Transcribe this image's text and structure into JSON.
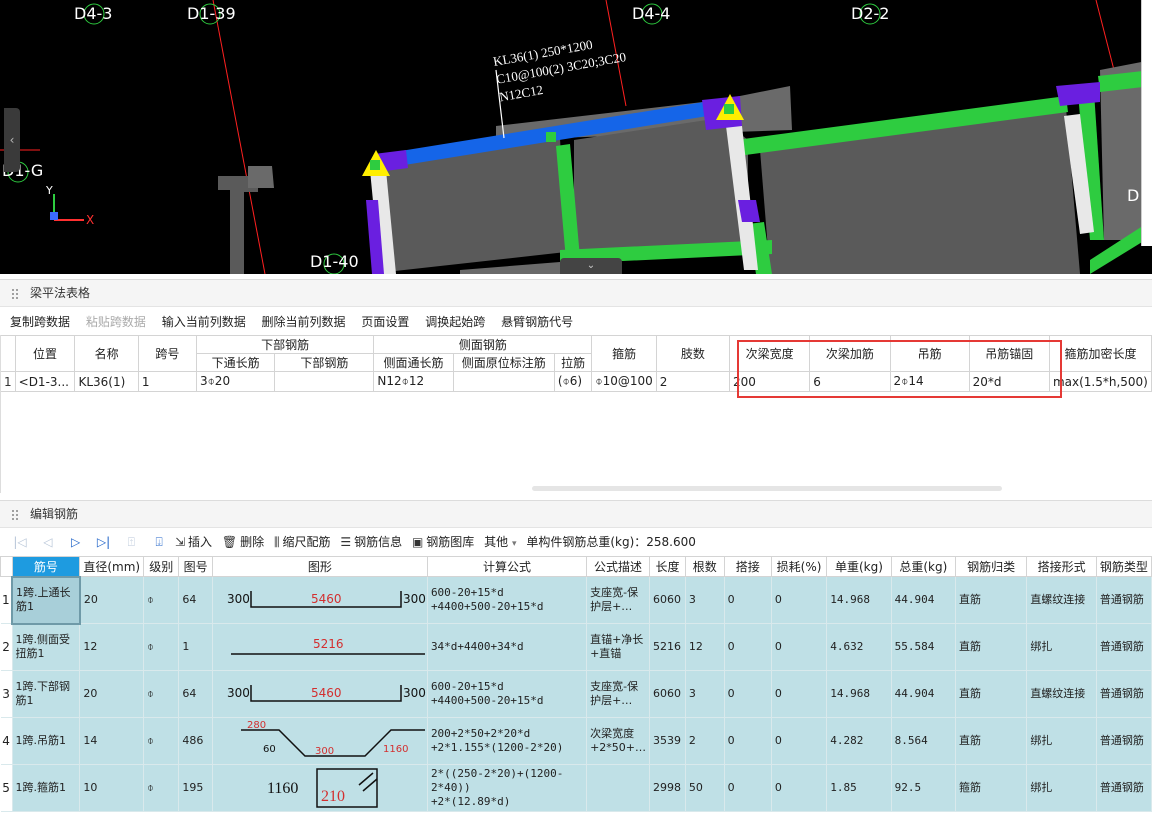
{
  "viewport": {
    "axis_labels": [
      "D4-3",
      "D1-39",
      "D4-4",
      "D2-2",
      "D1-G",
      "D1-40",
      "D"
    ],
    "beam_annotation": [
      "KL36(1) 250*1200",
      "C10@100(2) 3C20;3C20",
      "N12C12"
    ],
    "coord_axes": {
      "x": "X",
      "y": "Y"
    },
    "colors": {
      "background": "#000000",
      "beam_blue": "#1565e8",
      "beam_green": "#2ecc40",
      "column_purple": "#6a1fe0",
      "beam_gray": "#5a5a5a",
      "grid_red": "#ff2020"
    }
  },
  "beam_panel": {
    "title": "梁平法表格",
    "toolbar": [
      {
        "label": "复制跨数据",
        "enabled": true
      },
      {
        "label": "粘贴跨数据",
        "enabled": false
      },
      {
        "label": "输入当前列数据",
        "enabled": true
      },
      {
        "label": "删除当前列数据",
        "enabled": true
      },
      {
        "label": "页面设置",
        "enabled": true
      },
      {
        "label": "调换起始跨",
        "enabled": true
      },
      {
        "label": "悬臂钢筋代号",
        "enabled": true
      }
    ],
    "group_headers": {
      "bottom_rebar": "下部钢筋",
      "side_rebar": "侧面钢筋"
    },
    "headers": [
      "位置",
      "名称",
      "跨号",
      "下通长筋",
      "下部钢筋",
      "侧面通长筋",
      "侧面原位标注筋",
      "拉筋",
      "箍筋",
      "肢数",
      "次梁宽度",
      "次梁加筋",
      "吊筋",
      "吊筋锚固",
      "箍筋加密长度"
    ],
    "row": {
      "num": "1",
      "cells": [
        "<D1-3...",
        "KL36(1)",
        "1",
        "3⌽20",
        "",
        "N12⌽12",
        "",
        "(⌽6)",
        "⌽10@100",
        "2",
        "200",
        "6",
        "2⌽14",
        "20*d",
        "max(1.5*h,500)"
      ]
    }
  },
  "rebar_panel": {
    "title": "编辑钢筋",
    "toolbar": {
      "insert": "插入",
      "delete": "删除",
      "scale": "缩尺配筋",
      "info": "钢筋信息",
      "library": "钢筋图库",
      "other": "其他",
      "total_label": "单构件钢筋总重(kg)：258.600"
    },
    "headers": [
      "筋号",
      "直径(mm)",
      "级别",
      "图号",
      "图形",
      "计算公式",
      "公式描述",
      "长度",
      "根数",
      "搭接",
      "损耗(%)",
      "单重(kg)",
      "总重(kg)",
      "钢筋归类",
      "搭接形式",
      "钢筋类型"
    ],
    "rows": [
      {
        "num": "1",
        "name": "1跨.上通长筋1",
        "dia": "20",
        "grade": "⌽",
        "fig": "64",
        "shape": {
          "left": "300",
          "mid": "5460",
          "right": "300"
        },
        "formula": "600-20+15*d\n+4400+500-20+15*d",
        "desc": "支座宽-保护层+…",
        "length": "6060",
        "count": "3",
        "lap": "0",
        "loss": "0",
        "unit_w": "14.968",
        "total_w": "44.904",
        "category": "直筋",
        "lap_type": "直螺纹连接",
        "type": "普通钢筋"
      },
      {
        "num": "2",
        "name": "1跨.侧面受扭筋1",
        "dia": "12",
        "grade": "⌽",
        "fig": "1",
        "shape": {
          "mid": "5216"
        },
        "formula": "34*d+4400+34*d",
        "desc": "直锚+净长+直锚",
        "length": "5216",
        "count": "12",
        "lap": "0",
        "loss": "0",
        "unit_w": "4.632",
        "total_w": "55.584",
        "category": "直筋",
        "lap_type": "绑扎",
        "type": "普通钢筋"
      },
      {
        "num": "3",
        "name": "1跨.下部钢筋1",
        "dia": "20",
        "grade": "⌽",
        "fig": "64",
        "shape": {
          "left": "300",
          "mid": "5460",
          "right": "300"
        },
        "formula": "600-20+15*d\n+4400+500-20+15*d",
        "desc": "支座宽-保护层+…",
        "length": "6060",
        "count": "3",
        "lap": "0",
        "loss": "0",
        "unit_w": "14.968",
        "total_w": "44.904",
        "category": "直筋",
        "lap_type": "直螺纹连接",
        "type": "普通钢筋"
      },
      {
        "num": "4",
        "name": "1跨.吊筋1",
        "dia": "14",
        "grade": "⌽",
        "fig": "486",
        "shape": {
          "a": "280",
          "b": "60",
          "c": "300",
          "d": "1160"
        },
        "formula": "200+2*50+2*20*d\n+2*1.155*(1200-2*20)",
        "desc": "次梁宽度+2*50+…",
        "length": "3539",
        "count": "2",
        "lap": "0",
        "loss": "0",
        "unit_w": "4.282",
        "total_w": "8.564",
        "category": "直筋",
        "lap_type": "绑扎",
        "type": "普通钢筋"
      },
      {
        "num": "5",
        "name": "1跨.箍筋1",
        "dia": "10",
        "grade": "⌽",
        "fig": "195",
        "shape": {
          "h": "1160",
          "w": "210"
        },
        "formula": "2*((250-2*20)+(1200-2*40))\n+2*(12.89*d)",
        "desc": "",
        "length": "2998",
        "count": "50",
        "lap": "0",
        "loss": "0",
        "unit_w": "1.85",
        "total_w": "92.5",
        "category": "箍筋",
        "lap_type": "绑扎",
        "type": "普通钢筋"
      }
    ]
  }
}
